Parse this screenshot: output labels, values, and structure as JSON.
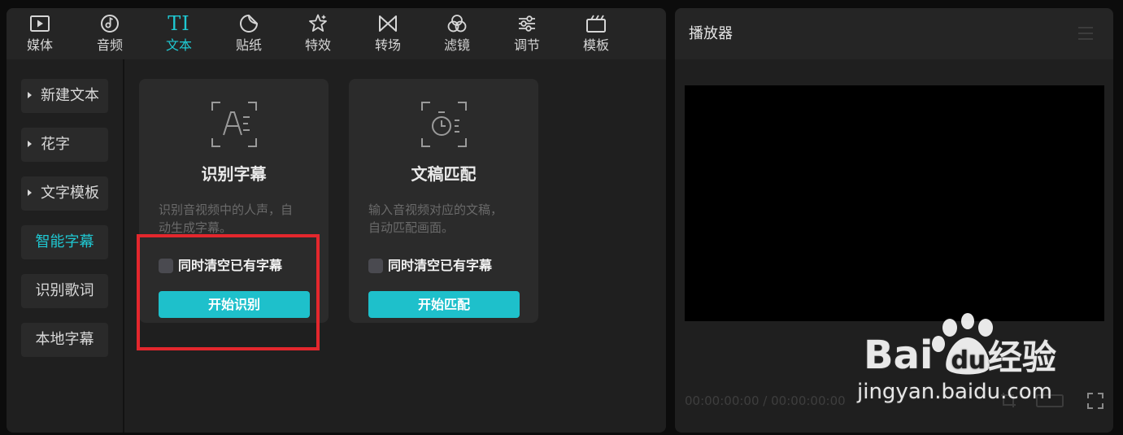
{
  "toolbar": {
    "tabs": [
      {
        "label": "媒体",
        "icon": "media-icon"
      },
      {
        "label": "音频",
        "icon": "audio-icon"
      },
      {
        "label": "文本",
        "icon": "text-icon",
        "glyph": "TI",
        "active": true
      },
      {
        "label": "贴纸",
        "icon": "sticker-icon"
      },
      {
        "label": "特效",
        "icon": "effects-icon"
      },
      {
        "label": "转场",
        "icon": "transition-icon"
      },
      {
        "label": "滤镜",
        "icon": "filter-icon"
      },
      {
        "label": "调节",
        "icon": "adjust-icon"
      },
      {
        "label": "模板",
        "icon": "template-icon"
      }
    ]
  },
  "sidebar": {
    "items": [
      {
        "label": "新建文本",
        "has_caret": true
      },
      {
        "label": "花字",
        "has_caret": true
      },
      {
        "label": "文字模板",
        "has_caret": true
      },
      {
        "label": "智能字幕",
        "active": true
      },
      {
        "label": "识别歌词"
      },
      {
        "label": "本地字幕"
      }
    ]
  },
  "cards": [
    {
      "icon": "recognize-subtitle-icon",
      "title": "识别字幕",
      "desc_line1": "识别音视频中的人声，自",
      "desc_line2": "动生成字幕。",
      "checkbox_label": "同时清空已有字幕",
      "checked": false,
      "button_label": "开始识别"
    },
    {
      "icon": "script-match-icon",
      "title": "文稿匹配",
      "desc_line1": "输入音视频对应的文稿，",
      "desc_line2": "自动匹配画面。",
      "checkbox_label": "同时清空已有字幕",
      "checked": false,
      "button_label": "开始匹配"
    }
  ],
  "player": {
    "title": "播放器",
    "current_time": "00:00:00:00",
    "separator": "/",
    "total_time": "00:00:00:00"
  },
  "watermark": {
    "brand_latin": "Bai",
    "brand_du": "du",
    "brand_cn": "经验",
    "url": "jingyan.baidu.com"
  },
  "colors": {
    "accent": "#1fc8d2",
    "button": "#1ec0cb",
    "highlight_box": "#e3272d",
    "panel": "#1f1f1f",
    "header": "#252525",
    "card": "#2b2b2b"
  }
}
